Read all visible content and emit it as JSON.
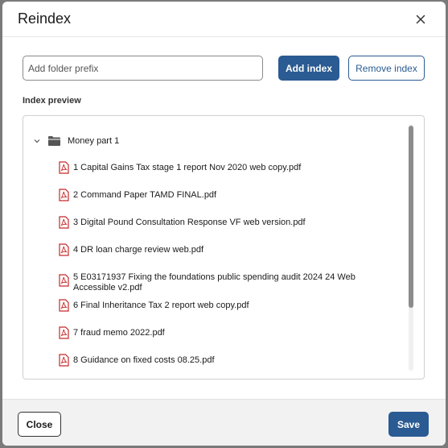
{
  "dialog": {
    "title": "Reindex",
    "close_icon": "close-icon"
  },
  "prefix": {
    "placeholder": "Add folder prefix",
    "value": ""
  },
  "buttons": {
    "add_index": "Add index",
    "remove_index": "Remove index",
    "close": "Close",
    "save": "Save"
  },
  "preview": {
    "label": "Index preview",
    "folder": {
      "name": "Money part 1",
      "expanded": true,
      "icon": "folder-icon"
    },
    "files": [
      "1 Capital Gains Tax stage 1 report Nov 2020 web copy.pdf",
      "2 Command Paper TAMD FINAL.pdf",
      "3 Digital Pound Consultation Response VF web version.pdf",
      "4 DR loan charge review web.pdf",
      "5 E03171937 Fixing the foundations public spending audit 2024 24 Web Accessible v2.pdf",
      "6 Final Inheritance Tax 2 report web copy.pdf",
      "7 fraud memo 2022.pdf",
      "8 Guidance on fixed costs 08.25.pdf"
    ],
    "file_icon": "pdf-icon"
  },
  "colors": {
    "primary": "#2a5b92",
    "pdf_red": "#c62828"
  }
}
